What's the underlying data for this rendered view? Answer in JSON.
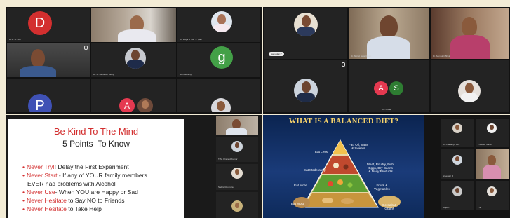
{
  "meeting": {
    "top_left": {
      "tiles": [
        {
          "kind": "avatar",
          "initial": "D",
          "color": "#d32f2f",
          "name": "Dr.D. G. Moi"
        },
        {
          "kind": "video",
          "name": ""
        },
        {
          "kind": "photo",
          "name": "Dr. Vidya R Nair S. Ipati"
        },
        {
          "kind": "video",
          "name": ""
        },
        {
          "kind": "photo",
          "name": "Dr. M. Ashutosh Mony"
        },
        {
          "kind": "avatar",
          "initial": "g",
          "color": "#43a047",
          "name": "Gurruswamy"
        },
        {
          "kind": "avatar",
          "initial": "P",
          "color": "#3f51b5",
          "name": ""
        },
        {
          "kind": "pair",
          "initials": [
            "A"
          ],
          "name": ""
        },
        {
          "kind": "photo",
          "name": ""
        }
      ]
    },
    "top_right": {
      "tiles": [
        {
          "kind": "photo",
          "name": "Samadari P"
        },
        {
          "kind": "video",
          "name": "Dr. Shiraz Salal Rajan"
        },
        {
          "kind": "video",
          "name": "Dr. Samruthi Bhole"
        },
        {
          "kind": "photo",
          "name": ""
        },
        {
          "kind": "pair",
          "initials": [
            "A",
            "S"
          ],
          "name": "KP Ansari"
        },
        {
          "kind": "photo",
          "name": ""
        }
      ]
    },
    "slide_left": {
      "title": "Be Kind To The Mind",
      "subtitle": "5 Points  To Know",
      "bullets": [
        {
          "key": "Never Try!",
          "rest": "! Delay the First Experiment"
        },
        {
          "key": "Never Start",
          "rest": " - If any of YOUR family members"
        },
        {
          "key": "",
          "rest": "EVER had problems with Alcohol"
        },
        {
          "key": "Never Use",
          "rest": "- When YOU are Happy or Sad"
        },
        {
          "key": "Never Hesitate",
          "rest": " to Say NO to Friends"
        },
        {
          "key": "Never Hesitate",
          "rest": " to Take Help"
        }
      ],
      "side_tiles": [
        {
          "name": ""
        },
        {
          "name": "T. M. Pramod Kumar"
        },
        {
          "name": "Sudha Ravindra"
        },
        {
          "name": ""
        }
      ]
    },
    "slide_right": {
      "title": "WHAT IS A BALANCED DIET?",
      "pyramid_labels": [
        "Fat, Oil, Salts\n& Sweets",
        "Meat, Poultry, Fish,\nEggs, Dry Beans\n& Dairy Products",
        "Fruits &\nVegetables",
        "Cereals &\nGrains"
      ],
      "level_labels": [
        "Eat Less",
        "Eat Moderately",
        "Eat More",
        "Eat Most"
      ],
      "side_tiles": [
        {
          "name": "Dr. Chaitanya Dev"
        },
        {
          "name": "Prakash Sahani"
        },
        {
          "name": "Sreenath R"
        },
        {
          "name": ""
        },
        {
          "name": "Rajesh"
        },
        {
          "name": "The"
        }
      ]
    }
  }
}
